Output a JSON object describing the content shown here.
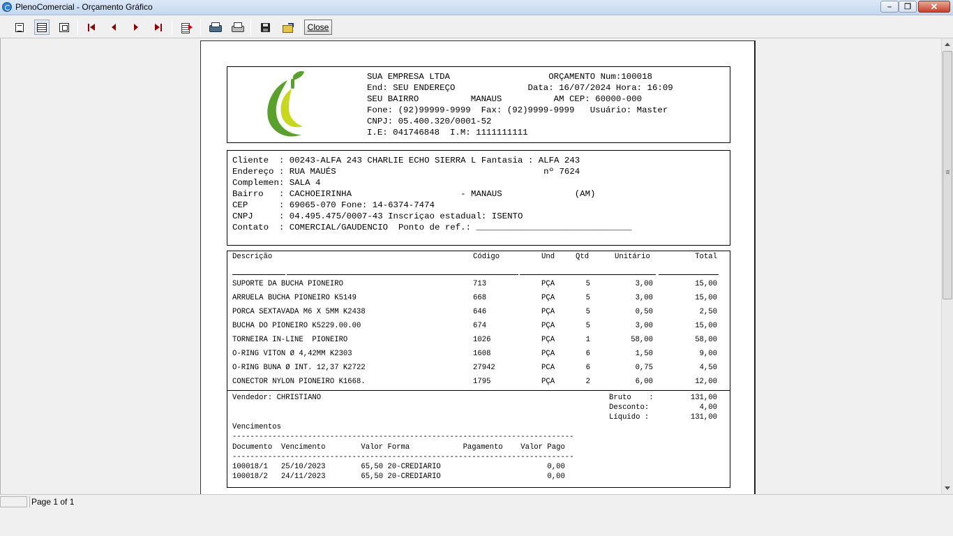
{
  "window": {
    "title": "PlenoComercial - Orçamento Gráfico"
  },
  "toolbar": {
    "close_label": "Close"
  },
  "company": {
    "lines": [
      "SUA EMPRESA LTDA                   ORÇAMENTO Num:100018",
      "End: SEU ENDEREÇO              Data: 16/07/2024 Hora: 16:09",
      "SEU BAIRRO          MANAUS          AM CEP: 60000-000",
      "Fone: (92)99999-9999  Fax: (92)9999-9999   Usuário: Master",
      "CNPJ: 05.400.320/0001-52",
      "I.E: 041746848  I.M: 1111111111"
    ]
  },
  "client": {
    "lines": [
      "Cliente  : 00243-ALFA 243 CHARLIE ECHO SIERRA L Fantasia : ALFA 243",
      "Endereço : RUA MAUÉS                                        nº 7624",
      "Complemen: SALA 4",
      "Bairro   : CACHOEIRINHA                     - MANAUS              (AM)",
      "CEP      : 69065-070 Fone: 14-6374-7474",
      "CNPJ     : 04.495.475/0007-43 Inscriçao estadual: ISENTO",
      "Contato  : COMERCIAL/GAUDENCIO  Ponto de ref.: ______________________________"
    ]
  },
  "items": {
    "headers": {
      "desc": "Descrição",
      "code": "Código",
      "unit": "Und",
      "qty": "Qtd",
      "unit_price": "Unitário",
      "total": "Total"
    },
    "rows": [
      {
        "desc": "SUPORTE DA BUCHA PIONEIRO",
        "code": "713",
        "unit": "PÇA",
        "qty": "5",
        "unit_price": "3,00",
        "total": "15,00"
      },
      {
        "desc": "ARRUELA BUCHA PIONEIRO K5149",
        "code": "668",
        "unit": "PÇA",
        "qty": "5",
        "unit_price": "3,00",
        "total": "15,00"
      },
      {
        "desc": "PORCA SEXTAVADA M6 X 5MM K2438",
        "code": "646",
        "unit": "PÇA",
        "qty": "5",
        "unit_price": "0,50",
        "total": "2,50"
      },
      {
        "desc": "BUCHA DO PIONEIRO K5229.00.00",
        "code": "674",
        "unit": "PÇA",
        "qty": "5",
        "unit_price": "3,00",
        "total": "15,00"
      },
      {
        "desc": "TORNEIRA IN-LINE  PIONEIRO",
        "code": "1026",
        "unit": "PÇA",
        "qty": "1",
        "unit_price": "58,00",
        "total": "58,00"
      },
      {
        "desc": "O-RING VITON Ø 4,42MM K2303",
        "code": "1608",
        "unit": "PÇA",
        "qty": "6",
        "unit_price": "1,50",
        "total": "9,00"
      },
      {
        "desc": "O-RING BUNA Ø INT. 12,37 K2722",
        "code": "27942",
        "unit": "PCA",
        "qty": "6",
        "unit_price": "0,75",
        "total": "4,50"
      },
      {
        "desc": "CONECTOR NYLON PIONEIRO K1668.",
        "code": "1795",
        "unit": "PÇA",
        "qty": "2",
        "unit_price": "6,00",
        "total": "12,00"
      }
    ]
  },
  "footer": {
    "seller": "Vendedor: CHRISTIANO",
    "bruto_label": "Bruto    :",
    "bruto_value": "131,00",
    "desconto_label": "Desconto:",
    "desconto_value": "4,00",
    "liquido_label": "Líquido :",
    "liquido_value": "131,00",
    "vencimentos_label": "Vencimentos",
    "dash_line": "-----------------------------------------------------------------------------",
    "header_line": "Documento  Vencimento        Valor Forma            Pagamento    Valor Pago",
    "installments": [
      "100018/1   25/10/2023        65,50 20-CREDIARIO                        0,00",
      "100018/2   24/11/2023        65,50 20-CREDIARIO                        0,00"
    ]
  },
  "status": {
    "page": "Page 1 of 1"
  }
}
